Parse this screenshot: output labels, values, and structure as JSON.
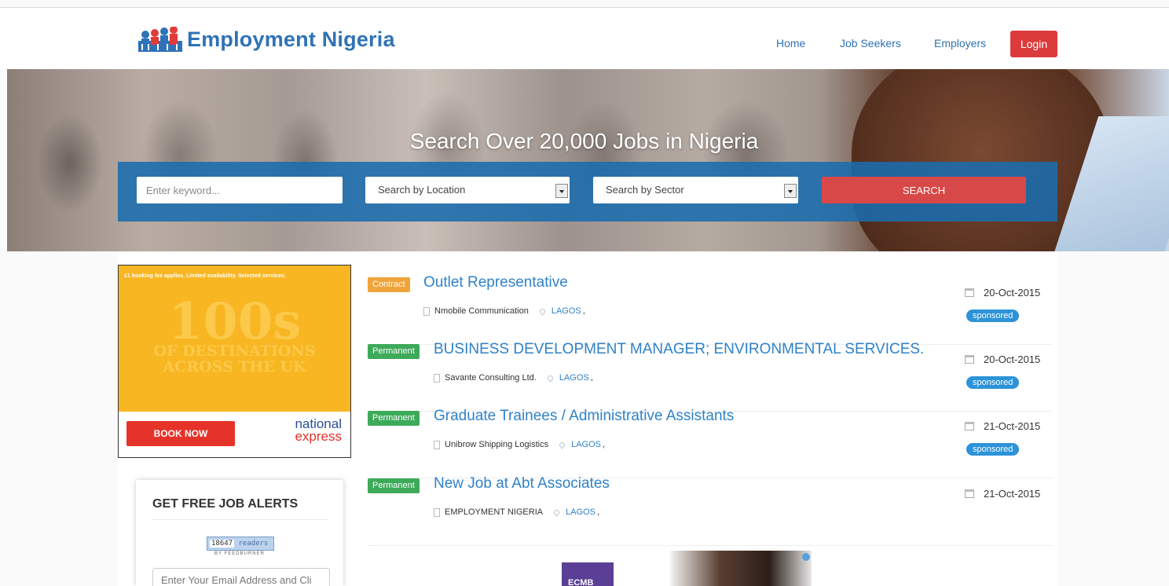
{
  "brand": {
    "name": "Employment Nigeria"
  },
  "nav": {
    "home": "Home",
    "job_seekers": "Job Seekers",
    "employers": "Employers",
    "login": "Login"
  },
  "hero": {
    "title": "Search Over 20,000 Jobs in Nigeria",
    "keyword_placeholder": "Enter keyword...",
    "location_select": "Search by Location",
    "sector_select": "Search by Sector",
    "search_button": "SEARCH"
  },
  "ad": {
    "fine_print": "£1 booking fee applies. Limited availability. Selected services.",
    "headline": "100s",
    "subline": "OF DESTINATIONS ACROSS THE UK",
    "cta": "BOOK NOW",
    "brand_line1": "national",
    "brand_line2": "express"
  },
  "alerts": {
    "title": "GET FREE JOB ALERTS",
    "count": "18647",
    "readers": "readers",
    "by": "BY FEEDBURNER",
    "email_placeholder": "Enter Your Email Address and Cli"
  },
  "jobs": [
    {
      "type": "Contract",
      "title": "Outlet Representative",
      "company": "Nmobile Communication",
      "location": "LAGOS",
      "date": "20-Oct-2015",
      "tag": "sponsored"
    },
    {
      "type": "Permanent",
      "title": "BUSINESS DEVELOPMENT MANAGER; ENVIRONMENTAL SERVICES.",
      "company": "Savante Consulting Ltd.",
      "location": "LAGOS",
      "date": "20-Oct-2015",
      "tag": "sponsored"
    },
    {
      "type": "Permanent",
      "title": "Graduate Trainees / Administrative Assistants",
      "company": "Unibrow Shipping Logistics",
      "location": "LAGOS",
      "date": "21-Oct-2015",
      "tag": "sponsored"
    },
    {
      "type": "Permanent",
      "title": "New Job at Abt Associates",
      "company": "EMPLOYMENT NIGERIA",
      "location": "LAGOS",
      "date": "21-Oct-2015",
      "tag": ""
    }
  ],
  "bottom_ad": {
    "label": "ECMB"
  },
  "colors": {
    "brand_blue": "#2f72b6",
    "login_red": "#db3b3b",
    "search_red": "#d94848",
    "contract_orange": "#f0a43a",
    "permanent_green": "#3daa5a",
    "sponsored_blue": "#2c93d8"
  }
}
